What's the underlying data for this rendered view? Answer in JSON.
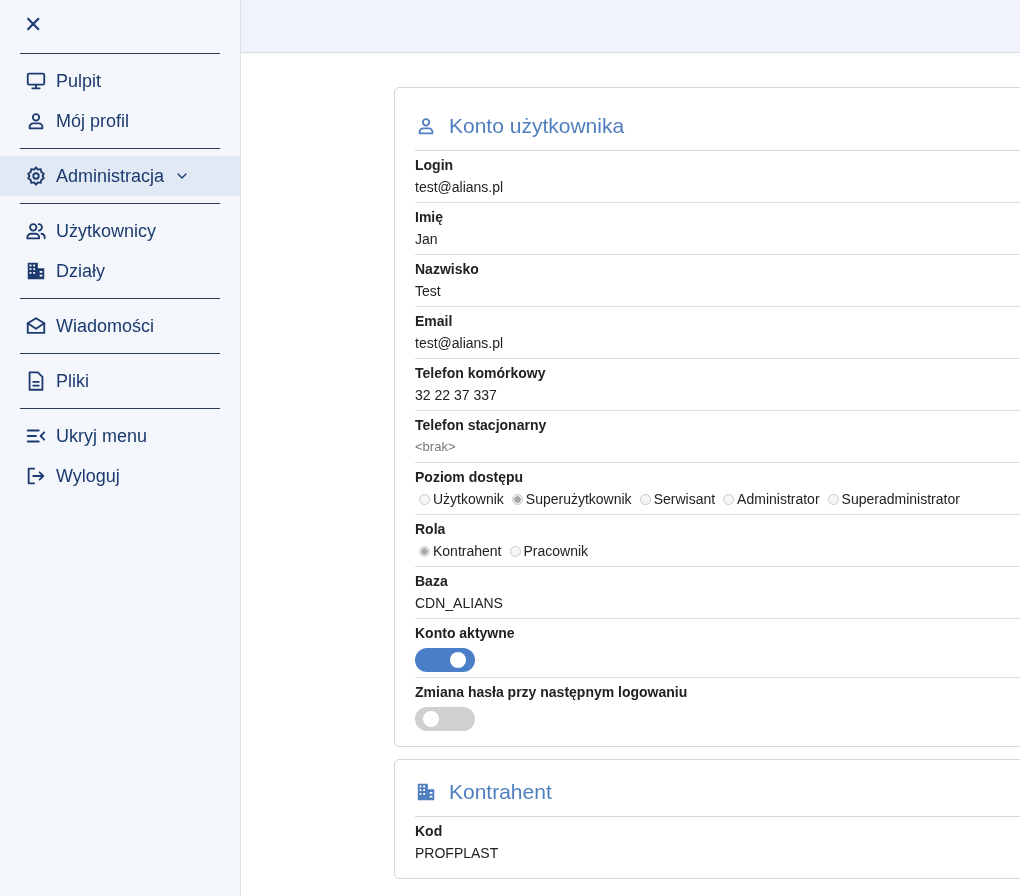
{
  "sidebar": {
    "close_button": "✕",
    "groups": [
      {
        "items": [
          {
            "label": "Pulpit",
            "selected": false
          },
          {
            "label": "Mój profil",
            "selected": false
          }
        ]
      },
      {
        "items": [
          {
            "label": "Administracja",
            "selected": true,
            "expanded": true
          }
        ]
      },
      {
        "items": [
          {
            "label": "Użytkownicy",
            "selected": false
          },
          {
            "label": "Działy",
            "selected": false
          }
        ]
      },
      {
        "items": [
          {
            "label": "Wiadomości",
            "selected": false
          }
        ]
      },
      {
        "items": [
          {
            "label": "Pliki",
            "selected": false
          }
        ]
      },
      {
        "items": [
          {
            "label": "Ukryj menu",
            "selected": false
          },
          {
            "label": "Wyloguj",
            "selected": false
          }
        ]
      }
    ]
  },
  "cards": [
    {
      "title": "Konto użytkownika",
      "fields": [
        {
          "kind": "text",
          "label": "Login",
          "value": "test@alians.pl"
        },
        {
          "kind": "text",
          "label": "Imię",
          "value": "Jan"
        },
        {
          "kind": "text",
          "label": "Nazwisko",
          "value": "Test"
        },
        {
          "kind": "text",
          "label": "Email",
          "value": "test@alians.pl"
        },
        {
          "kind": "text",
          "label": "Telefon komórkowy",
          "value": "32 22 37 337"
        },
        {
          "kind": "text",
          "label": "Telefon stacjonarny",
          "placeholder": "<brak>"
        },
        {
          "kind": "radio",
          "label": "Poziom dostępu",
          "options": [
            {
              "label": "Użytkownik",
              "selected": false
            },
            {
              "label": "Superużytkownik",
              "selected": true
            },
            {
              "label": "Serwisant",
              "selected": false
            },
            {
              "label": "Administrator",
              "selected": false
            },
            {
              "label": "Superadministrator",
              "selected": false
            }
          ]
        },
        {
          "kind": "radio",
          "label": "Rola",
          "options": [
            {
              "label": "Kontrahent",
              "selected": true
            },
            {
              "label": "Pracownik",
              "selected": false
            }
          ]
        },
        {
          "kind": "text",
          "label": "Baza",
          "value": "CDN_ALIANS"
        },
        {
          "kind": "toggle",
          "label": "Konto aktywne",
          "on": true
        },
        {
          "kind": "toggle",
          "label": "Zmiana hasła przy następnym logowaniu",
          "on": false
        }
      ]
    },
    {
      "title": "Kontrahent",
      "fields": [
        {
          "kind": "text",
          "label": "Kod",
          "value": "PROFPLAST"
        }
      ]
    }
  ]
}
